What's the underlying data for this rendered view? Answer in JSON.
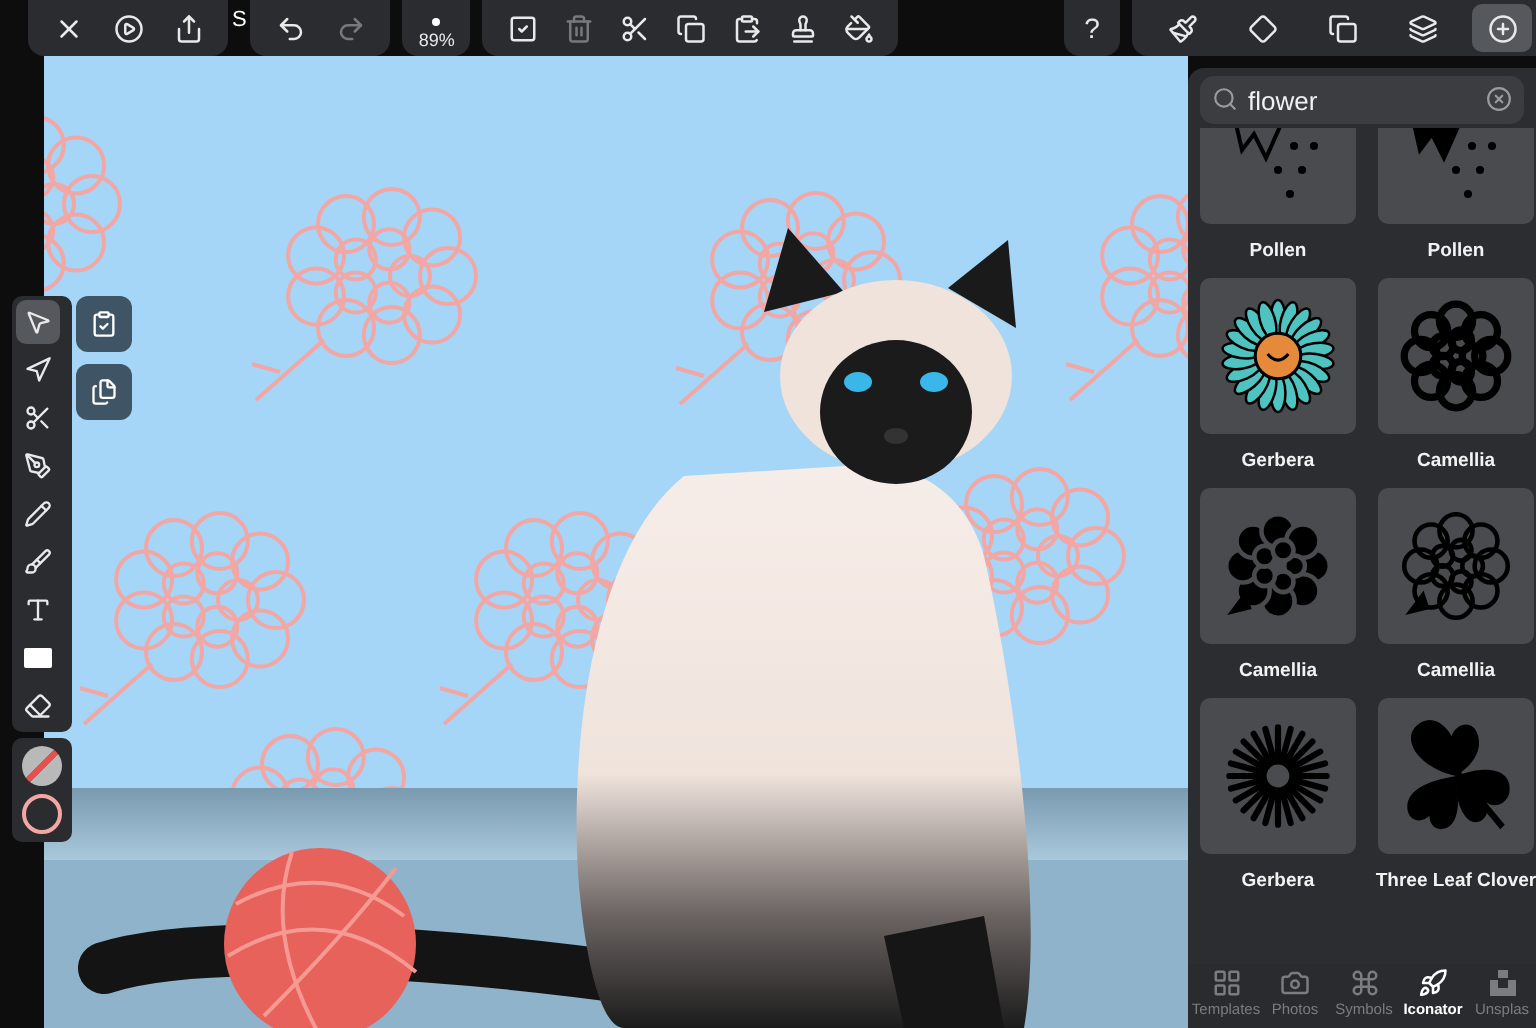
{
  "document_title": "S",
  "zoom": "89%",
  "help": "?",
  "inspector_tabs": [
    {
      "selected": false
    },
    {
      "selected": false
    },
    {
      "selected": false
    },
    {
      "selected": false
    },
    {
      "selected": true
    }
  ],
  "tools": [
    {
      "selected": true
    },
    {
      "selected": false
    },
    {
      "selected": false
    },
    {
      "selected": false
    },
    {
      "selected": false
    },
    {
      "selected": false
    },
    {
      "selected": false
    },
    {
      "selected": false
    },
    {
      "selected": false
    }
  ],
  "library": {
    "search": {
      "value": "flower"
    },
    "results": [
      {
        "label": "Pollen",
        "kind": "pollen"
      },
      {
        "label": "Pollen",
        "kind": "pollen-filled"
      },
      {
        "label": "Gerbera",
        "kind": "gerbera"
      },
      {
        "label": "Camellia",
        "kind": "camellia"
      },
      {
        "label": "Camellia",
        "kind": "camellia-filled"
      },
      {
        "label": "Camellia",
        "kind": "camellia-thin"
      },
      {
        "label": "Gerbera",
        "kind": "gerbera-burst"
      },
      {
        "label": "Three Leaf Clover",
        "kind": "clover"
      }
    ],
    "tabs": [
      {
        "label": "Templates",
        "selected": false
      },
      {
        "label": "Photos",
        "selected": false
      },
      {
        "label": "Symbols",
        "selected": false
      },
      {
        "label": "Iconator",
        "selected": true
      },
      {
        "label": "Unsplas",
        "selected": false
      }
    ]
  }
}
